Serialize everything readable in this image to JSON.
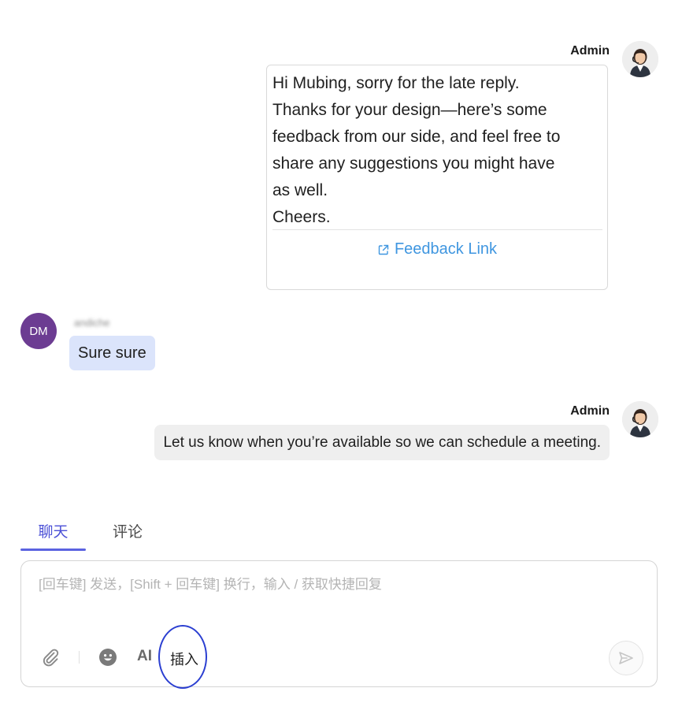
{
  "messages": [
    {
      "sender": "Admin",
      "lines": [
        "Hi Mubing, sorry for the late reply.",
        "Thanks for your design—here’s some",
        "feedback from our side, and feel free to",
        "share any suggestions you might have",
        "as well.",
        "Cheers."
      ],
      "link_label": "Feedback Link",
      "link_icon": "external-link-icon"
    },
    {
      "sender": "andiche",
      "avatar_initials": "DM",
      "avatar_color": "#6c3c92",
      "text": "Sure sure",
      "bubble_color": "#dbe4fb"
    },
    {
      "sender": "Admin",
      "text": "Let us know when you’re available so we can schedule a meeting.",
      "bubble_color": "#efefef"
    }
  ],
  "tabs": [
    {
      "label": "聊天",
      "active": true
    },
    {
      "label": "评论",
      "active": false
    }
  ],
  "composer": {
    "placeholder": "[回车键] 发送，[Shift + 回车键] 换行，输入 / 获取快捷回复",
    "value": "",
    "toolbar": {
      "attach_icon": "paperclip-icon",
      "emoji_icon": "emoji-icon",
      "ai_label": "AI",
      "insert_label": "插入",
      "send_icon": "send-icon"
    }
  },
  "colors": {
    "accent": "#5b63e0",
    "link": "#3f96e0",
    "highlight_annotation": "#2b3fd1"
  }
}
